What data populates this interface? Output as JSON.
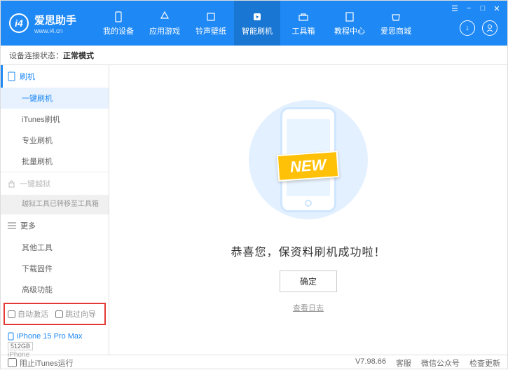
{
  "app": {
    "title": "爱思助手",
    "subtitle": "www.i4.cn"
  },
  "nav": [
    {
      "label": "我的设备"
    },
    {
      "label": "应用游戏"
    },
    {
      "label": "铃声壁纸"
    },
    {
      "label": "智能刷机"
    },
    {
      "label": "工具箱"
    },
    {
      "label": "教程中心"
    },
    {
      "label": "爱思商城"
    }
  ],
  "status": {
    "prefix": "设备连接状态：",
    "value": "正常模式"
  },
  "sidebar": {
    "flash": {
      "title": "刷机",
      "items": [
        "一键刷机",
        "iTunes刷机",
        "专业刷机",
        "批量刷机"
      ]
    },
    "jailbreak": {
      "title": "一键越狱",
      "moved": "越狱工具已转移至工具箱"
    },
    "more": {
      "title": "更多",
      "items": [
        "其他工具",
        "下载固件",
        "高级功能"
      ]
    }
  },
  "checks": {
    "auto": "自动激活",
    "skip": "跳过向导"
  },
  "device": {
    "name": "iPhone 15 Pro Max",
    "storage": "512GB",
    "type": "iPhone"
  },
  "main": {
    "banner": "NEW",
    "success": "恭喜您，保资料刷机成功啦！",
    "ok": "确定",
    "log": "查看日志"
  },
  "footer": {
    "block": "阻止iTunes运行",
    "version": "V7.98.66",
    "links": [
      "客服",
      "微信公众号",
      "检查更新"
    ]
  }
}
